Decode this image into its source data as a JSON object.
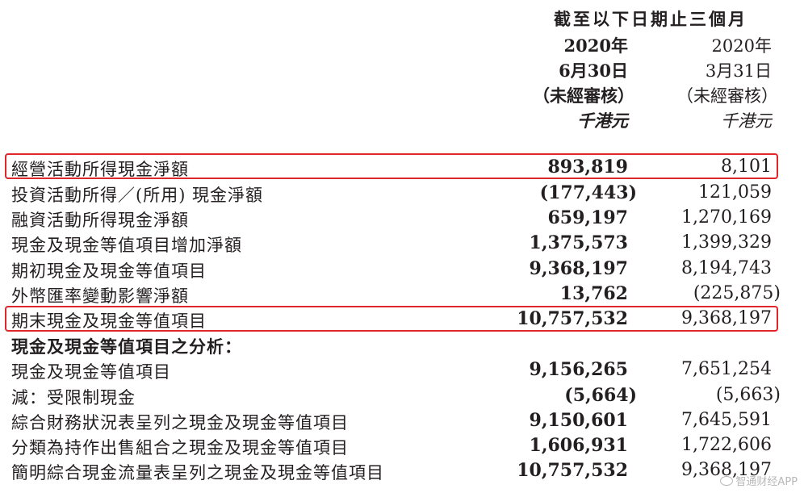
{
  "header": {
    "period": "截至以下日期止三個月",
    "col1": {
      "year": "2020年",
      "date": "6月30日",
      "audit": "（未經審核）",
      "unit": "千港元"
    },
    "col2": {
      "year": "2020年",
      "date": "3月31日",
      "audit": "（未經審核）",
      "unit": "千港元"
    }
  },
  "rows": [
    {
      "label": "經營活動所得現金淨額",
      "v1": "893,819",
      "v2": "8,101"
    },
    {
      "label": "投資活動所得／(所用) 現金淨額",
      "v1": "(177,443)",
      "v2": "121,059"
    },
    {
      "label": "融資活動所得現金淨額",
      "v1": "659,197",
      "v2": "1,270,169"
    },
    {
      "label": "現金及現金等值項目增加淨額",
      "v1": "1,375,573",
      "v2": "1,399,329"
    },
    {
      "label": "期初現金及現金等值項目",
      "v1": "9,368,197",
      "v2": "8,194,743"
    },
    {
      "label": "外幣匯率變動影響淨額",
      "v1": "13,762",
      "v2": "(225,875)"
    },
    {
      "label": "期末現金及現金等值項目",
      "v1": "10,757,532",
      "v2": "9,368,197"
    },
    {
      "label": "現金及現金等值項目之分析：",
      "v1": "",
      "v2": ""
    },
    {
      "label": "現金及現金等值項目",
      "v1": "9,156,265",
      "v2": "7,651,254"
    },
    {
      "label": "減：受限制現金",
      "v1": "(5,664)",
      "v2": "(5,663)"
    },
    {
      "label": "綜合財務狀況表呈列之現金及現金等值項目",
      "v1": "9,150,601",
      "v2": "7,645,591"
    },
    {
      "label": "分類為持作出售組合之現金及現金等值項目",
      "v1": "1,606,931",
      "v2": "1,722,606"
    },
    {
      "label": "簡明綜合現金流量表呈列之現金及現金等值項目",
      "v1": "10,757,532",
      "v2": "9,368,197"
    }
  ],
  "highlight_color": "#e0262b",
  "watermark": {
    "text": "智通财经APP",
    "icon": "zhitong-logo-icon"
  }
}
